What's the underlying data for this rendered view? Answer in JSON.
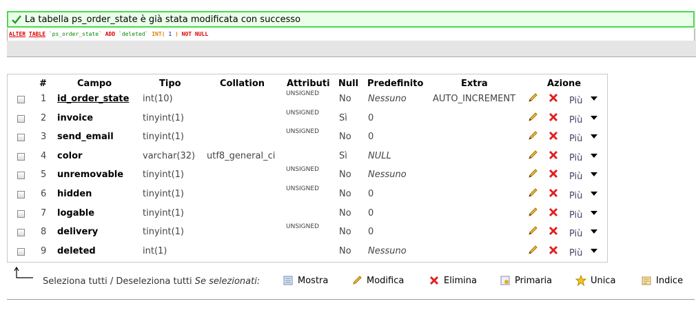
{
  "banner": {
    "message": "La tabella ps_order_state è già stata modificata con successo",
    "sql": {
      "alter": "ALTER",
      "table": "TABLE",
      "tbl": "`ps_order_state`",
      "add": "ADD",
      "col": "`deleted`",
      "int": "INT",
      "open": "(",
      "len": "1",
      "close": ")",
      "not": "NOT",
      "null": "NULL"
    }
  },
  "table": {
    "headers": {
      "num": "#",
      "campo": "Campo",
      "tipo": "Tipo",
      "collation": "Collation",
      "attributi": "Attributi",
      "null": "Null",
      "predefinito": "Predefinito",
      "extra": "Extra",
      "azione": "Azione"
    },
    "more_label": "Più",
    "rows": [
      {
        "num": "1",
        "name": "id_order_state",
        "type": "int(10)",
        "collation": "",
        "attr": "UNSIGNED",
        "null": "No",
        "default": "Nessuno",
        "extra": "AUTO_INCREMENT"
      },
      {
        "num": "2",
        "name": "invoice",
        "type": "tinyint(1)",
        "collation": "",
        "attr": "UNSIGNED",
        "null": "Sì",
        "default": "0",
        "extra": ""
      },
      {
        "num": "3",
        "name": "send_email",
        "type": "tinyint(1)",
        "collation": "",
        "attr": "UNSIGNED",
        "null": "No",
        "default": "0",
        "extra": ""
      },
      {
        "num": "4",
        "name": "color",
        "type": "varchar(32)",
        "collation": "utf8_general_ci",
        "attr": "",
        "null": "Sì",
        "default": "NULL",
        "extra": ""
      },
      {
        "num": "5",
        "name": "unremovable",
        "type": "tinyint(1)",
        "collation": "",
        "attr": "UNSIGNED",
        "null": "No",
        "default": "Nessuno",
        "extra": ""
      },
      {
        "num": "6",
        "name": "hidden",
        "type": "tinyint(1)",
        "collation": "",
        "attr": "UNSIGNED",
        "null": "No",
        "default": "0",
        "extra": ""
      },
      {
        "num": "7",
        "name": "logable",
        "type": "tinyint(1)",
        "collation": "",
        "attr": "",
        "null": "No",
        "default": "0",
        "extra": ""
      },
      {
        "num": "8",
        "name": "delivery",
        "type": "tinyint(1)",
        "collation": "",
        "attr": "UNSIGNED",
        "null": "No",
        "default": "0",
        "extra": ""
      },
      {
        "num": "9",
        "name": "deleted",
        "type": "int(1)",
        "collation": "",
        "attr": "",
        "null": "No",
        "default": "Nessuno",
        "extra": ""
      }
    ]
  },
  "footer": {
    "select_all": "Seleziona tutti / Deseleziona tutti",
    "with_selected": "Se selezionati:",
    "actions": {
      "browse": "Mostra",
      "change": "Modifica",
      "drop": "Elimina",
      "primary": "Primaria",
      "unique": "Unica",
      "index": "Indice"
    }
  },
  "colors": {
    "success_border": "#4ad94a",
    "success_bg": "#eaffea",
    "sql_keyword": "#dd0000",
    "sql_string": "#008800"
  }
}
